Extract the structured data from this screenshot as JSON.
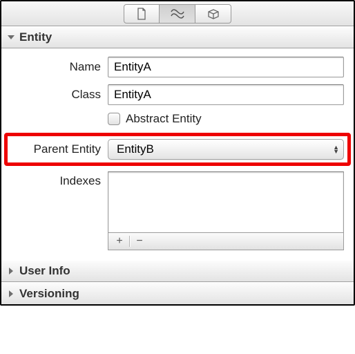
{
  "toolbar": {
    "tab1_icon": "document-icon",
    "tab2_icon": "identity-icon",
    "tab3_icon": "box-icon"
  },
  "sections": {
    "entity": {
      "title": "Entity",
      "fields": {
        "name_label": "Name",
        "name_value": "EntityA",
        "class_label": "Class",
        "class_value": "EntityA",
        "abstract_label": "Abstract Entity",
        "parent_label": "Parent Entity",
        "parent_value": "EntityB",
        "indexes_label": "Indexes"
      }
    },
    "userinfo": {
      "title": "User Info"
    },
    "versioning": {
      "title": "Versioning"
    }
  },
  "buttons": {
    "plus": "+",
    "minus": "−"
  }
}
